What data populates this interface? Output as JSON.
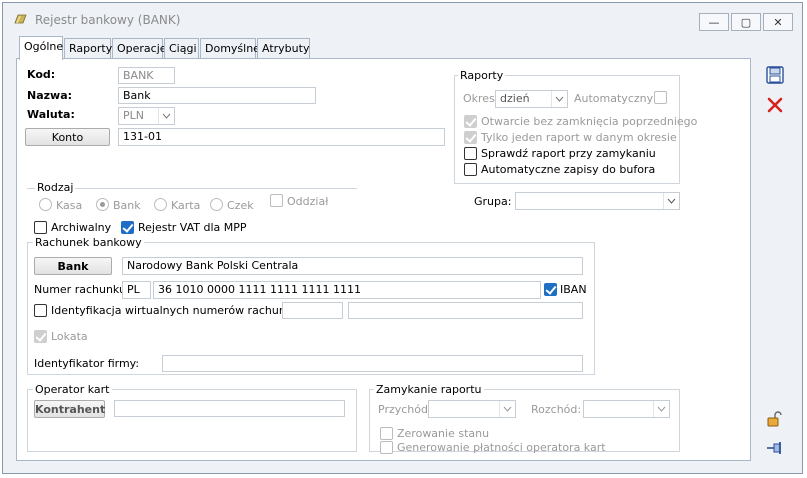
{
  "window": {
    "title": "Rejestr bankowy (BANK)",
    "minimize": "—",
    "maximize": "▢",
    "close": "✕"
  },
  "tabs": [
    {
      "label": "Ogólne"
    },
    {
      "label": "Raporty"
    },
    {
      "label": "Operacje"
    },
    {
      "label": "Ciągi"
    },
    {
      "label": "Domyślne"
    },
    {
      "label": "Atrybuty"
    }
  ],
  "form": {
    "kod_label": "Kod:",
    "kod_value": "BANK",
    "nazwa_label": "Nazwa:",
    "nazwa_value": "Bank",
    "waluta_label": "Waluta:",
    "waluta_value": "PLN",
    "konto_button": "Konto",
    "konto_value": "131-01"
  },
  "raporty": {
    "title": "Raporty",
    "okres_label": "Okres:",
    "okres_value": "dzień",
    "automatyczny_label": "Automatyczny",
    "otwarcie": "Otwarcie bez zamknięcia poprzedniego",
    "jeden": "Tylko jeden raport w danym okresie",
    "sprawdz": "Sprawdź raport przy zamykaniu",
    "auto_zapisy": "Automatyczne zapisy do bufora"
  },
  "rodzaj": {
    "title": "Rodzaj",
    "kasa": "Kasa",
    "bank": "Bank",
    "karta": "Karta",
    "czek": "Czek",
    "oddzial": "Oddział"
  },
  "grupa_label": "Grupa:",
  "archiwalny": "Archiwalny",
  "rejestr_vat": "Rejestr VAT dla MPP",
  "rachunek": {
    "title": "Rachunek bankowy",
    "bank_button": "Bank",
    "bank_name": "Narodowy Bank Polski Centrala",
    "numer_label": "Numer rachunku:",
    "kraj": "PL",
    "numer": "36 1010 0000 1111 1111 1111 1111",
    "iban": "IBAN",
    "identyfikacja": "Identyfikacja wirtualnych numerów rachunków",
    "lokata": "Lokata",
    "identyfikator_label": "Identyfikator firmy:"
  },
  "operator": {
    "title": "Operator kart",
    "kontrahent_button": "Kontrahent"
  },
  "zamykanie": {
    "title": "Zamykanie raportu",
    "przychod_label": "Przychód:",
    "rozchod_label": "Rozchód:",
    "zerowanie": "Zerowanie stanu",
    "generowanie": "Generowanie płatności operatora kart"
  },
  "colors": {
    "accent": "#1e6fc4",
    "save": "#2a4f9a",
    "delete": "#d6211e"
  }
}
